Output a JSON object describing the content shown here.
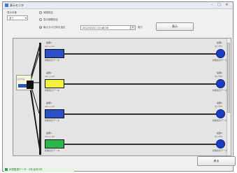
{
  "window": {
    "title": "表示モニタ",
    "minimize": "–",
    "maximize": "□",
    "close": "✕"
  },
  "controls": {
    "section_label": "表示対象",
    "select_value": "全て",
    "radio_options": [
      "時間指定",
      "表示期間指定",
      "最大分の日時を指定"
    ],
    "date_value": "2012/03/21 10:48:36",
    "date_suffix": "実行",
    "display_button": "表示"
  },
  "hub": {
    "label": "(((•)))"
  },
  "nodes": [
    {
      "label_top": "設備1",
      "sub_label": "ユニット1",
      "box_label": "",
      "box_color": "#2a4fc8",
      "end_label": "設備1",
      "end_sub": "センサ1",
      "bottom_label": "状態表示データ",
      "end_bottom": "状態表示データ"
    },
    {
      "label_top": "設備2",
      "sub_label": "ユニット2",
      "box_label": "",
      "box_color": "#f2f23c",
      "end_label": "設備2",
      "end_sub": "センサ2",
      "bottom_label": "状態表示データ",
      "end_bottom": "状態表示データ"
    },
    {
      "label_top": "設備3",
      "sub_label": "ユニット3",
      "box_label": "",
      "box_color": "#2a4fc8",
      "end_label": "設備3",
      "end_sub": "センサ3",
      "bottom_label": "状態表示データ",
      "end_bottom": "状態表示データ"
    },
    {
      "label_top": "設備4",
      "sub_label": "ユニット4",
      "box_label": "",
      "box_color": "#2ab84a",
      "end_label": "設備4",
      "end_sub": "センサ4",
      "bottom_label": "状態表示データ",
      "end_bottom": "状態表示データ"
    }
  ],
  "footer": {
    "back_button": "戻る",
    "status_text": "状態監視データ：0件/全件0件"
  },
  "colors": {
    "accent": "#2a4fc8",
    "endpoint": "#1a3fc4"
  }
}
